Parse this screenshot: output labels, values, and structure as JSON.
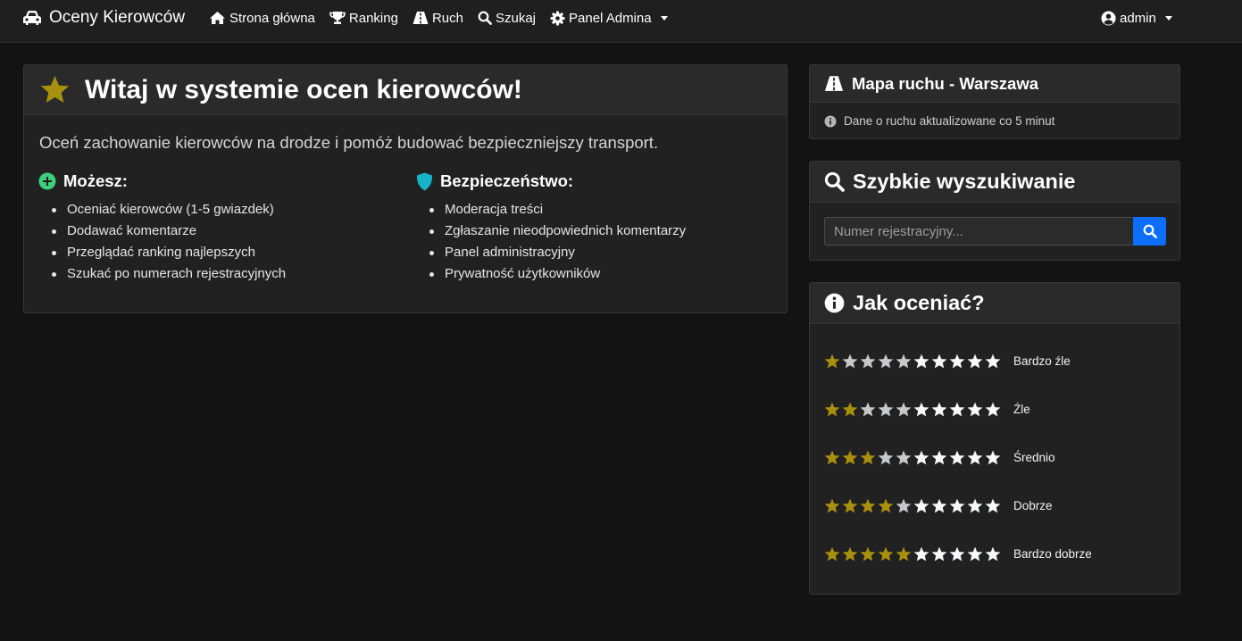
{
  "navbar": {
    "brand": "Oceny Kierowców",
    "items": [
      {
        "label": "Strona główna",
        "icon": "home-icon"
      },
      {
        "label": "Ranking",
        "icon": "trophy-icon"
      },
      {
        "label": "Ruch",
        "icon": "road-icon"
      },
      {
        "label": "Szukaj",
        "icon": "search-icon"
      },
      {
        "label": "Panel Admina",
        "icon": "gear-icon"
      }
    ],
    "user": "admin"
  },
  "welcome": {
    "title": "Witaj w systemie ocen kierowców!",
    "lead": "Oceń zachowanie kierowców na drodze i pomóż budować bezpieczniejszy transport.",
    "can": {
      "heading": "Możesz:",
      "items": [
        "Oceniać kierowców (1-5 gwiazdek)",
        "Dodawać komentarze",
        "Przeglądać ranking najlepszych",
        "Szukać po numerach rejestracyjnych"
      ]
    },
    "security": {
      "heading": "Bezpieczeństwo:",
      "items": [
        "Moderacja treści",
        "Zgłaszanie nieodpowiednich komentarzy",
        "Panel administracyjny",
        "Prywatność użytkowników"
      ]
    }
  },
  "traffic": {
    "title": "Mapa ruchu - Warszawa",
    "info": "Dane o ruchu aktualizowane co 5 minut"
  },
  "quick_search": {
    "title": "Szybkie wyszukiwanie",
    "placeholder": "Numer rejestracyjny..."
  },
  "how_to_rate": {
    "title": "Jak oceniać?",
    "ratings": [
      {
        "label": "Bardzo źle",
        "gold": 1,
        "light": 4,
        "white": 5
      },
      {
        "label": "Źle",
        "gold": 2,
        "light": 3,
        "white": 5
      },
      {
        "label": "Średnio",
        "gold": 3,
        "light": 2,
        "white": 5
      },
      {
        "label": "Dobrze",
        "gold": 4,
        "light": 1,
        "white": 5
      },
      {
        "label": "Bardzo dobrze",
        "gold": 5,
        "light": 0,
        "white": 5
      }
    ]
  },
  "colors": {
    "star_gold": "#a8900c",
    "star_light": "#c6c9cc",
    "star_white": "#f8f9fa",
    "can_icon": "#3ecf7a",
    "shield_icon": "#17b3c9",
    "primary": "#0d6efd"
  }
}
